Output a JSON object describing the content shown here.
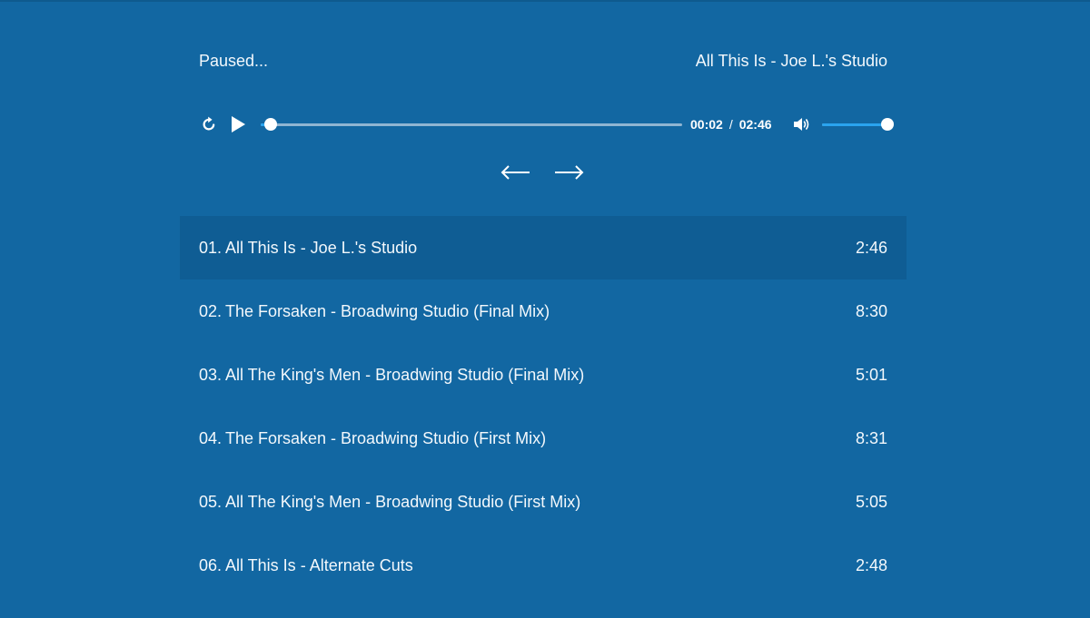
{
  "player": {
    "status": "Paused...",
    "now_playing": "All This Is - Joe L.'s Studio",
    "current_time": "00:02",
    "time_separator": "/",
    "total_time": "02:46",
    "progress_fraction": 0.012,
    "buffered_fraction": 0.95,
    "volume_fraction": 1.0,
    "accent_color": "#2aa4ef",
    "background_color": "#1267a2",
    "icons": {
      "restart": "restart-icon",
      "play": "play-icon",
      "volume": "volume-icon",
      "prev": "arrow-left-icon",
      "next": "arrow-right-icon"
    }
  },
  "playlist": [
    {
      "num": "01.",
      "title": "All This Is - Joe L.'s Studio",
      "duration": "2:46",
      "active": true
    },
    {
      "num": "02.",
      "title": "The Forsaken - Broadwing Studio (Final Mix)",
      "duration": "8:30",
      "active": false
    },
    {
      "num": "03.",
      "title": "All The King's Men - Broadwing Studio (Final Mix)",
      "duration": "5:01",
      "active": false
    },
    {
      "num": "04.",
      "title": "The Forsaken - Broadwing Studio (First Mix)",
      "duration": "8:31",
      "active": false
    },
    {
      "num": "05.",
      "title": "All The King's Men - Broadwing Studio (First Mix)",
      "duration": "5:05",
      "active": false
    },
    {
      "num": "06.",
      "title": "All This Is - Alternate Cuts",
      "duration": "2:48",
      "active": false
    }
  ]
}
